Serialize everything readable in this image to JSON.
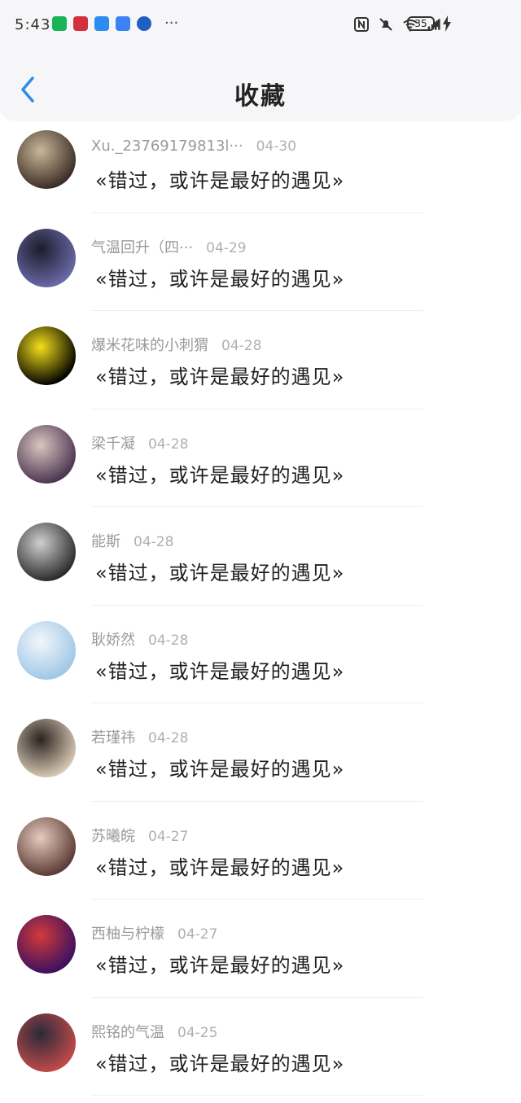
{
  "status_bar": {
    "time": "5:43",
    "more": "···",
    "battery": "35",
    "app_icons": [
      "green-app-icon",
      "huawei-app-icon",
      "chat-app-icon",
      "cloud-app-icon",
      "bank-app-icon"
    ],
    "system_icons": [
      "nfc-icon",
      "mute-icon",
      "wifi-icon",
      "signal-icon"
    ]
  },
  "header": {
    "title": "收藏",
    "back_icon": "back-arrow-icon",
    "accent": "#2f8be6"
  },
  "items": [
    {
      "name": "Xu._23769179813l···",
      "date": "04-30",
      "quote": "«错过，或许是最好的遇见»",
      "avatar": "owl-avatar",
      "colors": [
        "#3a2c24",
        "#c9b79a"
      ]
    },
    {
      "name": "气温回升（四···",
      "date": "04-29",
      "quote": "«错过，或许是最好的遇见»",
      "avatar": "couple-avatar",
      "colors": [
        "#6a6aa8",
        "#1c1c2c"
      ]
    },
    {
      "name": "爆米花味的小刺猬",
      "date": "04-28",
      "quote": "«错过，或许是最好的遇见»",
      "avatar": "tnt-logo-avatar",
      "colors": [
        "#000000",
        "#f5e01a"
      ]
    },
    {
      "name": "梁千凝",
      "date": "04-28",
      "quote": "«错过，或许是最好的遇见»",
      "avatar": "anime-girl-avatar",
      "colors": [
        "#4a3550",
        "#d9c5c0"
      ]
    },
    {
      "name": "能斯",
      "date": "04-28",
      "quote": "«错过，或许是最好的遇见»",
      "avatar": "bw-photo-avatar",
      "colors": [
        "#2a2a2a",
        "#cfcfcf"
      ]
    },
    {
      "name": "耿娇然",
      "date": "04-28",
      "quote": "«错过，或许是最好的遇见»",
      "avatar": "anime-boy-avatar",
      "colors": [
        "#9fc7e6",
        "#f2f6fb"
      ]
    },
    {
      "name": "若瑾祎",
      "date": "04-28",
      "quote": "«错过，或许是最好的遇见»",
      "avatar": "hooded-person-avatar",
      "colors": [
        "#d8c9b5",
        "#2b2420"
      ]
    },
    {
      "name": "苏曦皖",
      "date": "04-27",
      "quote": "«错过，或许是最好的遇见»",
      "avatar": "portrait-avatar",
      "colors": [
        "#5a3a34",
        "#e6cbbd"
      ]
    },
    {
      "name": "西柚与柠檬",
      "date": "04-27",
      "quote": "«错过，或许是最好的遇见»",
      "avatar": "stage-performer-avatar",
      "colors": [
        "#3a1060",
        "#d23a3a"
      ]
    },
    {
      "name": "熙铭的气温",
      "date": "04-25",
      "quote": "«错过，或许是最好的遇见»",
      "avatar": "two-people-avatar",
      "colors": [
        "#c24a4a",
        "#2a2a3a"
      ]
    }
  ]
}
